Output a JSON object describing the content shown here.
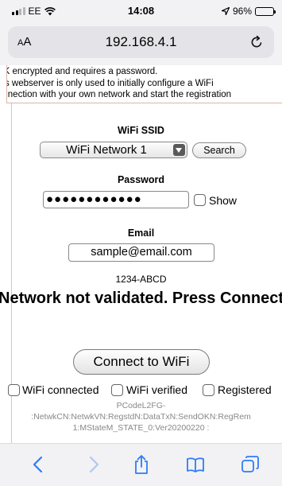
{
  "status_bar": {
    "carrier": "EE",
    "time": "14:08",
    "battery": "96%",
    "battery_level": 0.96
  },
  "browser": {
    "text_size_label": "AA",
    "url": "192.168.4.1"
  },
  "page": {
    "info_lines": [
      "SK encrypted and requires a password.",
      "his webserver is only used to initially configure a WiFi",
      "onnection with your own network and start the registration"
    ],
    "ssid_label": "WiFi SSID",
    "ssid_selected": "WiFi Network 1",
    "search_label": "Search",
    "password_label": "Password",
    "password_value": "●●●●●●●●●●●●",
    "show_label": "Show",
    "email_label": "Email",
    "email_value": "sample@email.com",
    "device_code": "1234-ABCD",
    "status_message": "Network not validated. Press Connect",
    "connect_label": "Connect to WiFi",
    "checks": {
      "wifi_connected": "WiFi connected",
      "wifi_verified": "WiFi verified",
      "registered": "Registered"
    },
    "debug_lines": [
      "PCodeL2FG-",
      ":NetwkCN:NetwkVN:RegstdN:DataTxN:SendOKN:RegRem",
      "1:MStateM_STATE_0:Ver20200220 :"
    ]
  },
  "toolbar": {
    "icons": [
      "back-icon",
      "forward-icon",
      "share-icon",
      "bookmarks-icon",
      "tabs-icon"
    ]
  },
  "colors": {
    "accent": "#2f7cf6",
    "disabled": "#b0c8ef"
  }
}
